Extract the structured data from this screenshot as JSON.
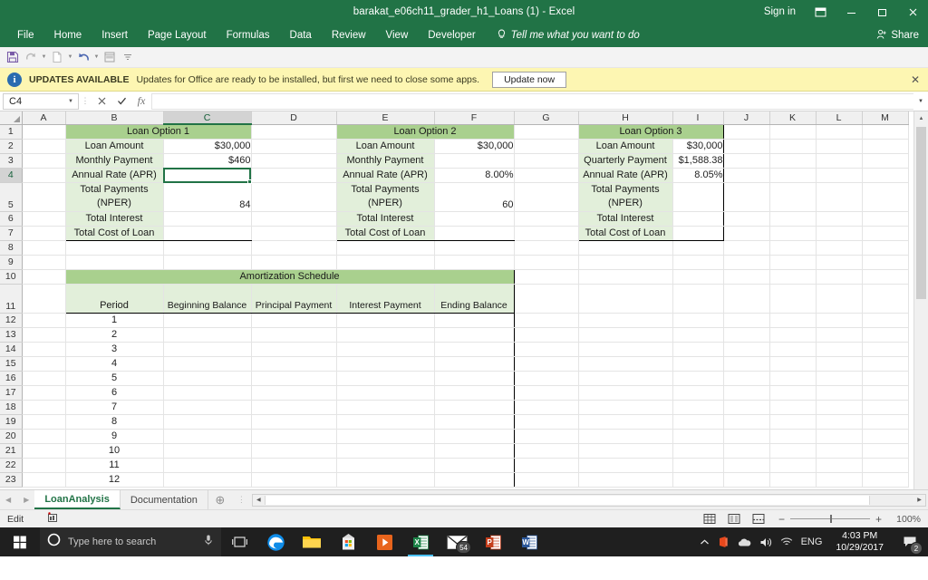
{
  "window": {
    "title": "barakat_e06ch11_grader_h1_Loans (1)  -  Excel",
    "signin": "Sign in",
    "ribbon_display_icon": "ribbon-display-options-icon",
    "minimize_icon": "minimize-icon",
    "restore_icon": "restore-icon",
    "close_icon": "close-icon"
  },
  "ribbon": {
    "tabs": [
      "File",
      "Home",
      "Insert",
      "Page Layout",
      "Formulas",
      "Data",
      "Review",
      "View",
      "Developer"
    ],
    "tellme": "Tell me what you want to do",
    "tellme_icon": "lightbulb-icon",
    "share": "Share",
    "share_icon": "person-share-icon"
  },
  "quick_access": {
    "icons": [
      "save-icon",
      "redo-icon",
      "new-icon",
      "undo-icon",
      "print-preview-icon",
      "customize-qat-icon"
    ]
  },
  "notification": {
    "icon": "info-icon",
    "bold_label": "UPDATES AVAILABLE",
    "message": "Updates for Office are ready to be installed, but first we need to close some apps.",
    "button": "Update now",
    "close_icon": "close-icon"
  },
  "formula_bar": {
    "name_box": "C4",
    "cancel_icon": "cancel-icon",
    "enter_icon": "enter-icon",
    "function_icon": "insert-function-icon",
    "value": "",
    "expand_icon": "expand-formula-bar-icon"
  },
  "grid": {
    "columns": [
      "A",
      "B",
      "C",
      "D",
      "E",
      "F",
      "G",
      "H",
      "I",
      "J",
      "K",
      "L",
      "M"
    ],
    "selected_column": "C",
    "selected_row": "4",
    "selected_cell": "C4",
    "rows": [
      "1",
      "2",
      "3",
      "4",
      "5",
      "6",
      "7",
      "8",
      "9",
      "10",
      "11",
      "12",
      "13",
      "14",
      "15",
      "16",
      "17",
      "18",
      "19",
      "20",
      "21",
      "22",
      "23"
    ],
    "loan_option_1": {
      "title": "Loan Option 1",
      "labels": [
        "Loan Amount",
        "Monthly Payment",
        "Annual Rate (APR)",
        "Total Payments (NPER)",
        "Total Interest",
        "Total Cost of Loan"
      ],
      "label_line1": [
        "Loan Amount",
        "Monthly Payment",
        "Annual Rate (APR)",
        "Total Payments",
        "Total Interest",
        "Total Cost of Loan"
      ],
      "label_line2": [
        "",
        "",
        "",
        "(NPER)",
        "",
        ""
      ],
      "values": [
        "$30,000",
        "$460",
        "",
        "84",
        "",
        ""
      ]
    },
    "loan_option_2": {
      "title": "Loan Option 2",
      "label_line1": [
        "Loan Amount",
        "Monthly Payment",
        "Annual Rate (APR)",
        "Total Payments",
        "Total Interest",
        "Total Cost of Loan"
      ],
      "label_line2": [
        "",
        "",
        "",
        "(NPER)",
        "",
        ""
      ],
      "values": [
        "$30,000",
        "",
        "8.00%",
        "60",
        "",
        ""
      ]
    },
    "loan_option_3": {
      "title": "Loan Option 3",
      "label_line1": [
        "Loan Amount",
        "Quarterly Payment",
        "Annual Rate (APR)",
        "Total Payments",
        "Total Interest",
        "Total Cost of Loan"
      ],
      "label_line2": [
        "",
        "",
        "",
        "(NPER)",
        "",
        ""
      ],
      "values": [
        "$30,000",
        "$1,588.38",
        "8.05%",
        "",
        "",
        ""
      ]
    },
    "amortization": {
      "title": "Amortization Schedule",
      "headers": [
        "Period",
        "Beginning Balance",
        "Principal Payment",
        "Interest Payment",
        "Ending Balance"
      ],
      "periods": [
        "1",
        "2",
        "3",
        "4",
        "5",
        "6",
        "7",
        "8",
        "9",
        "10",
        "11",
        "12"
      ]
    }
  },
  "sheet_tabs": {
    "prev_icon": "prev-sheet-icon",
    "next_icon": "next-sheet-icon",
    "tabs": [
      {
        "label": "LoanAnalysis",
        "active": true
      },
      {
        "label": "Documentation",
        "active": false
      }
    ],
    "add_icon": "add-sheet-icon"
  },
  "status_bar": {
    "mode": "Edit",
    "macro_icon": "record-macro-icon",
    "view_normal_icon": "normal-view-icon",
    "view_pagelayout_icon": "page-layout-view-icon",
    "view_pagebreak_icon": "page-break-view-icon",
    "zoom_out_icon": "zoom-out-icon",
    "zoom_in_icon": "zoom-in-icon",
    "zoom": "100%"
  },
  "taskbar": {
    "start_icon": "windows-start-icon",
    "search_icon": "cortana-circle-icon",
    "search_placeholder": "Type here to search",
    "mic_icon": "microphone-icon",
    "taskview_icon": "task-view-icon",
    "apps": [
      {
        "name": "edge-icon",
        "label": "e"
      },
      {
        "name": "file-explorer-icon",
        "label": ""
      },
      {
        "name": "microsoft-store-icon",
        "label": ""
      },
      {
        "name": "media-player-icon",
        "label": ""
      },
      {
        "name": "excel-icon",
        "label": "X"
      },
      {
        "name": "mail-icon",
        "label": "",
        "badge": "54"
      },
      {
        "name": "powerpoint-icon",
        "label": "P"
      },
      {
        "name": "word-icon",
        "label": "W"
      }
    ],
    "tray": {
      "chevron_icon": "show-hidden-icons-icon",
      "office_icon": "office-upload-icon",
      "onedrive_icon": "onedrive-icon",
      "volume_icon": "volume-icon",
      "network_icon": "wifi-icon",
      "language": "ENG",
      "time": "4:03 PM",
      "date": "10/29/2017",
      "action_center_icon": "action-center-icon",
      "action_center_badge": "2"
    }
  },
  "colors": {
    "excel_green": "#217346",
    "header_green": "#a9d08e",
    "label_green": "#e2efda",
    "notif_yellow": "#fdf6b2"
  }
}
